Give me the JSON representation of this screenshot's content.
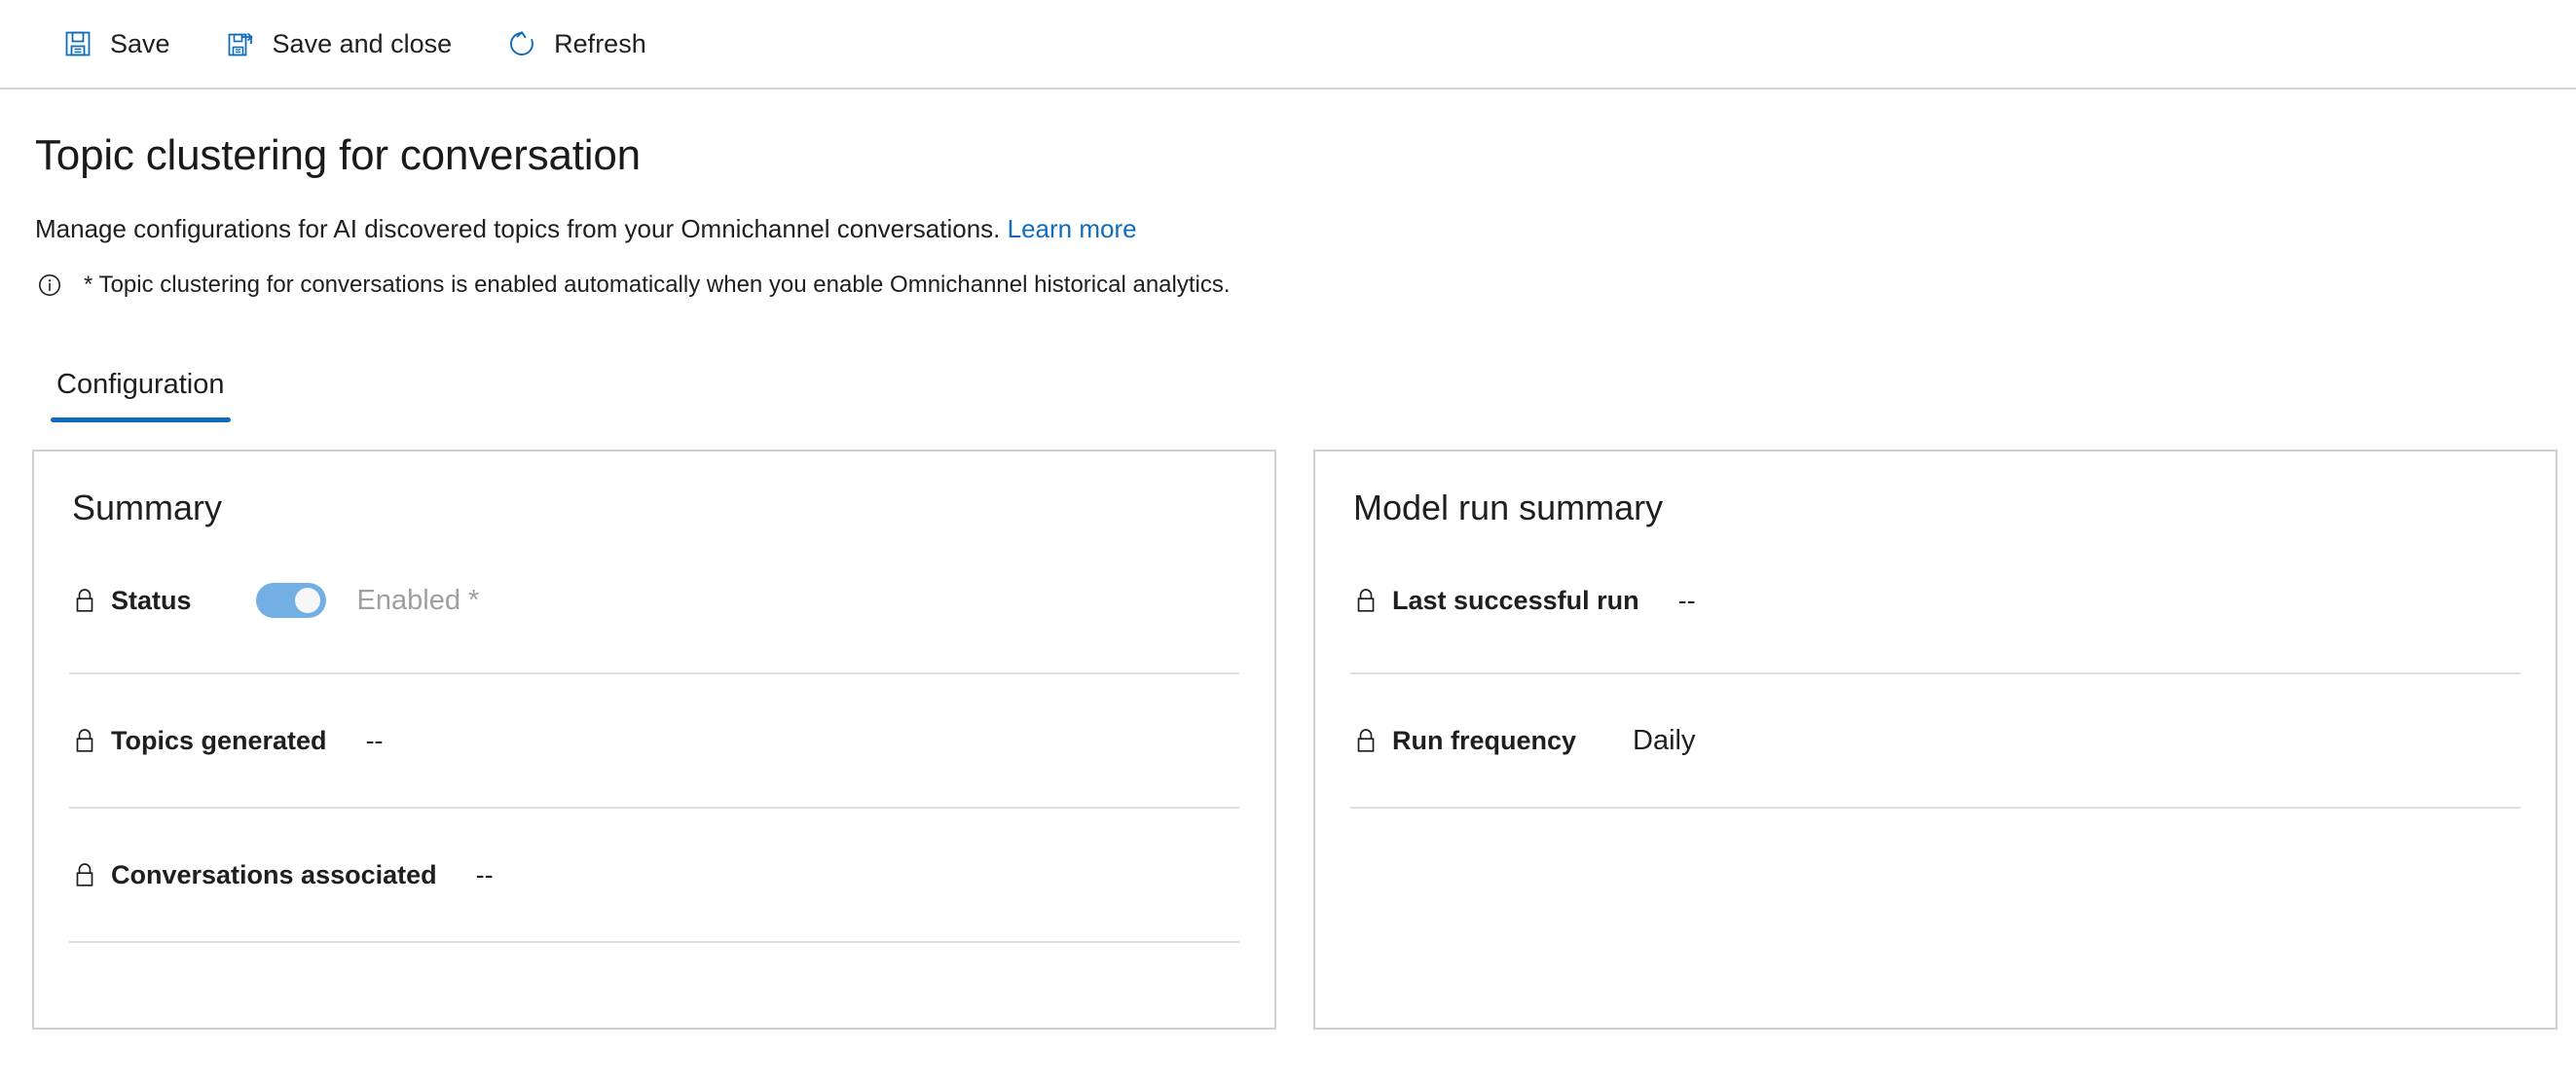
{
  "toolbar": {
    "buttons": [
      {
        "label": "Save",
        "icon": "save-icon"
      },
      {
        "label": "Save and close",
        "icon": "save-and-close-icon"
      },
      {
        "label": "Refresh",
        "icon": "refresh-icon"
      }
    ]
  },
  "header": {
    "title": "Topic clustering for conversation",
    "subtitle": "Manage configurations for AI discovered topics from your Omnichannel conversations.",
    "learn_more": "Learn more",
    "note_icon": "info-icon",
    "note": "* Topic clustering for conversations is enabled automatically when you enable Omnichannel historical analytics."
  },
  "tabs": [
    {
      "label": "Configuration",
      "active": true
    }
  ],
  "cards": [
    {
      "title": "Summary",
      "rows": [
        {
          "icon": "lock-icon",
          "label": "Status",
          "control": "toggle",
          "toggle_on": true,
          "value": "Enabled *"
        },
        {
          "icon": "lock-icon",
          "label": "Topics generated",
          "control": "text",
          "value": "--"
        },
        {
          "icon": "lock-icon",
          "label": "Conversations associated",
          "control": "text",
          "value": "--"
        }
      ]
    },
    {
      "title": "Model run summary",
      "rows": [
        {
          "icon": "lock-icon",
          "label": "Last successful run",
          "control": "text",
          "value": "--"
        },
        {
          "icon": "lock-icon",
          "label": "Run frequency",
          "control": "text-plain",
          "value": "Daily"
        }
      ]
    }
  ],
  "colors": {
    "accent": "#0f6cbd",
    "toggle_on": "#71afe5",
    "disabled_text": "#a19f9d",
    "card_border": "#d2d0ce",
    "divider": "#e1dfdd"
  }
}
